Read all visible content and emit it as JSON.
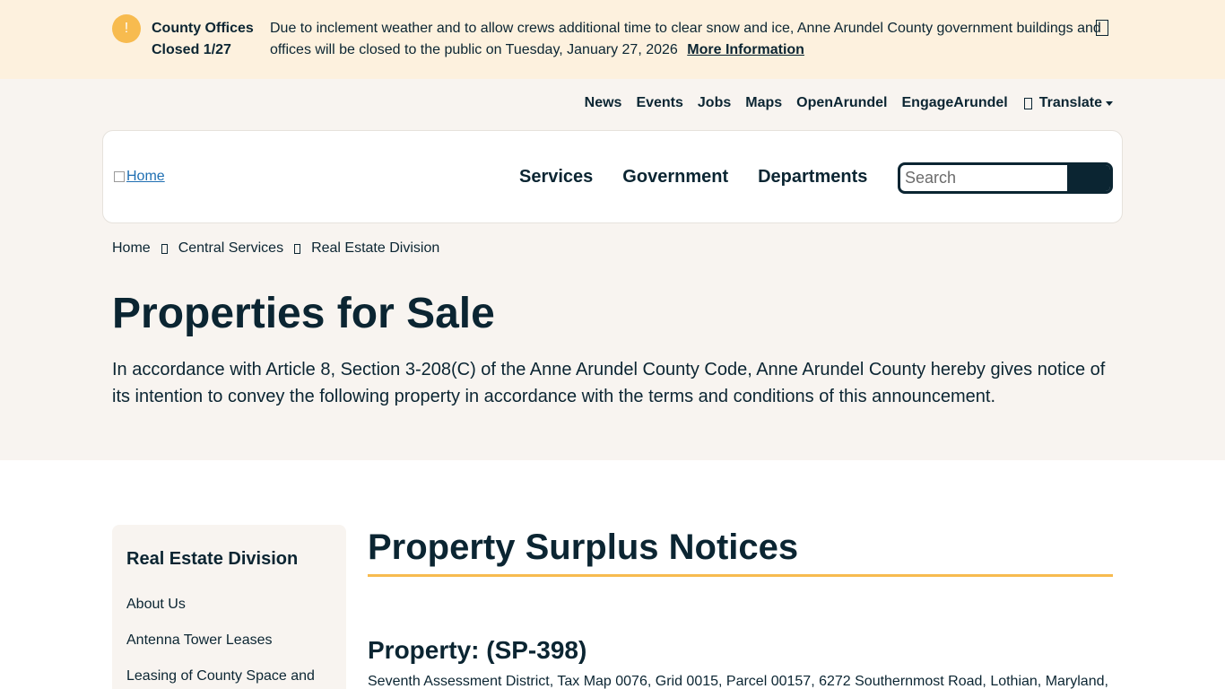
{
  "alert": {
    "icon": "exclamation-icon",
    "icon_glyph": "!",
    "title": "County Offices Closed 1/27",
    "message": "Due to inclement weather and to allow crews additional time to clear snow and ice, Anne Arundel County government buildings and offices will be closed to the public on Tuesday, January 27, 2026",
    "link_label": "More Information",
    "accent_color": "#f7bb4f",
    "background_color": "#fdf1de"
  },
  "utility_nav": {
    "items": [
      "News",
      "Events",
      "Jobs",
      "Maps",
      "OpenArundel",
      "EngageArundel"
    ],
    "translate_label": "Translate"
  },
  "header": {
    "logo_alt": "Home",
    "main_nav": [
      "Services",
      "Government",
      "Departments"
    ],
    "search_placeholder": "Search",
    "search_value": ""
  },
  "breadcrumb": [
    "Home",
    "Central Services",
    "Real Estate Division"
  ],
  "page": {
    "title": "Properties for Sale",
    "intro": "In accordance with Article 8, Section 3-208(C) of the Anne Arundel County Code, Anne Arundel County hereby gives notice of its intention to convey the following property in accordance with the terms and conditions of this announcement."
  },
  "sidebar": {
    "title": "Real Estate Division",
    "items": [
      "About Us",
      "Antenna Tower Leases",
      "Leasing of County Space and"
    ]
  },
  "content": {
    "section_title": "Property Surplus Notices",
    "property_title": "Property: (SP-398)",
    "property_desc": "Seventh Assessment District, Tax Map 0076, Grid 0015, Parcel 00157, 6272 Southernmost Road, Lothian, Maryland,"
  },
  "colors": {
    "text": "#0b2532",
    "hero_bg": "#f8f4f0",
    "accent": "#f7bb4f",
    "link": "#1f6fb2"
  }
}
